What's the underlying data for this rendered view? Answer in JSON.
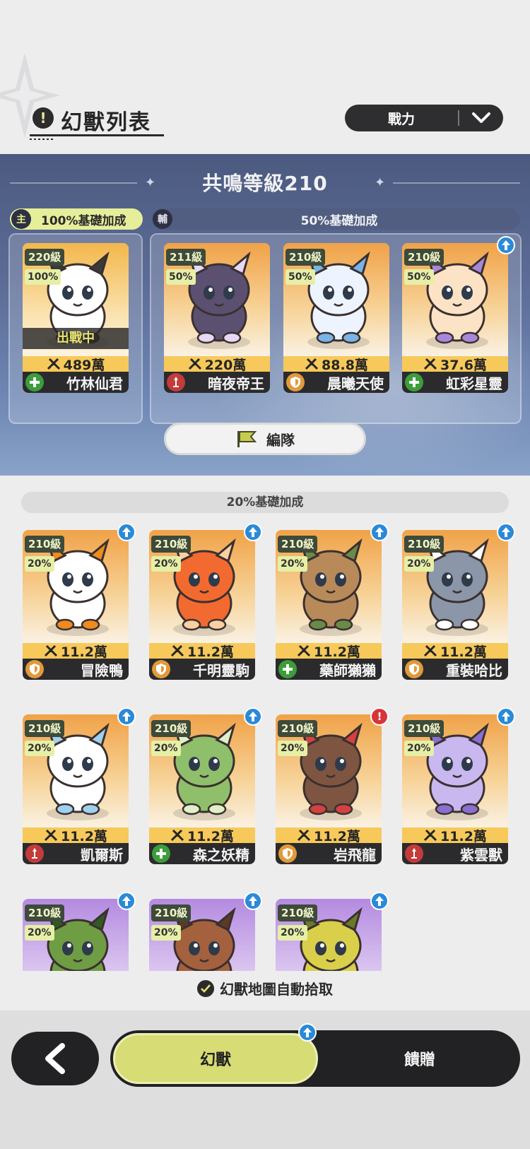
{
  "header": {
    "title": "幻獸列表",
    "title_icon": "!",
    "sort": {
      "selected": "戰力"
    }
  },
  "resonance": {
    "title": "共鳴等級210",
    "main_tag": {
      "badge": "主",
      "label": "100%基礎加成"
    },
    "sub_tag": {
      "badge": "輔",
      "label": "50%基礎加成"
    },
    "edit_button": "編隊",
    "team": [
      {
        "level": "220級",
        "pct": "100%",
        "power": "489萬",
        "name": "竹林仙君",
        "role": "support",
        "status": "出戰中",
        "theme": "gold",
        "upgrade": false
      },
      {
        "level": "211級",
        "pct": "50%",
        "power": "220萬",
        "name": "暗夜帝王",
        "role": "attack",
        "status": "",
        "theme": "orange",
        "upgrade": false
      },
      {
        "level": "210級",
        "pct": "50%",
        "power": "88.8萬",
        "name": "晨曦天使",
        "role": "defense",
        "status": "",
        "theme": "orange",
        "upgrade": false
      },
      {
        "level": "210級",
        "pct": "50%",
        "power": "37.6萬",
        "name": "虹彩星靈",
        "role": "support",
        "status": "",
        "theme": "orange",
        "upgrade": true
      }
    ]
  },
  "roster": {
    "section_label": "20%基礎加成",
    "cards": [
      {
        "level": "210級",
        "pct": "20%",
        "power": "11.2萬",
        "name": "冒險鴨",
        "role": "defense",
        "theme": "orange",
        "badge": "upgrade"
      },
      {
        "level": "210級",
        "pct": "20%",
        "power": "11.2萬",
        "name": "千明靈駒",
        "role": "defense",
        "theme": "orange",
        "badge": "upgrade"
      },
      {
        "level": "210級",
        "pct": "20%",
        "power": "11.2萬",
        "name": "藥師獺獺",
        "role": "support",
        "theme": "orange",
        "badge": "upgrade"
      },
      {
        "level": "210級",
        "pct": "20%",
        "power": "11.2萬",
        "name": "重裝哈比",
        "role": "defense",
        "theme": "orange",
        "badge": "upgrade"
      },
      {
        "level": "210級",
        "pct": "20%",
        "power": "11.2萬",
        "name": "凱爾斯",
        "role": "attack",
        "theme": "orange",
        "badge": "upgrade"
      },
      {
        "level": "210級",
        "pct": "20%",
        "power": "11.2萬",
        "name": "森之妖精",
        "role": "support",
        "theme": "orange",
        "badge": "upgrade"
      },
      {
        "level": "210級",
        "pct": "20%",
        "power": "11.2萬",
        "name": "岩飛龍",
        "role": "defense",
        "theme": "orange",
        "badge": "alert"
      },
      {
        "level": "210級",
        "pct": "20%",
        "power": "11.2萬",
        "name": "紫雲獸",
        "role": "attack",
        "theme": "orange",
        "badge": "upgrade"
      },
      {
        "level": "210級",
        "pct": "20%",
        "power": "",
        "name": "",
        "role": "",
        "theme": "purple",
        "badge": "upgrade"
      },
      {
        "level": "210級",
        "pct": "20%",
        "power": "",
        "name": "",
        "role": "",
        "theme": "purple",
        "badge": "upgrade"
      },
      {
        "level": "210級",
        "pct": "20%",
        "power": "",
        "name": "",
        "role": "",
        "theme": "purple",
        "badge": "upgrade"
      }
    ]
  },
  "auto_pickup": {
    "label": "幻獸地圖自動拾取",
    "checked": true
  },
  "bottom": {
    "tabs": [
      {
        "label": "幻獸",
        "active": true
      },
      {
        "label": "饋贈",
        "active": false
      }
    ]
  },
  "colors": {
    "accent": "#d7dc74",
    "card_orange": "#f0a248",
    "card_purple": "#b48ae0",
    "role_support": "#3c9d3a",
    "role_attack": "#c43b3b",
    "role_defense": "#e19a3a",
    "upgrade_badge": "#2a8ad8",
    "alert_badge": "#d8353a"
  }
}
